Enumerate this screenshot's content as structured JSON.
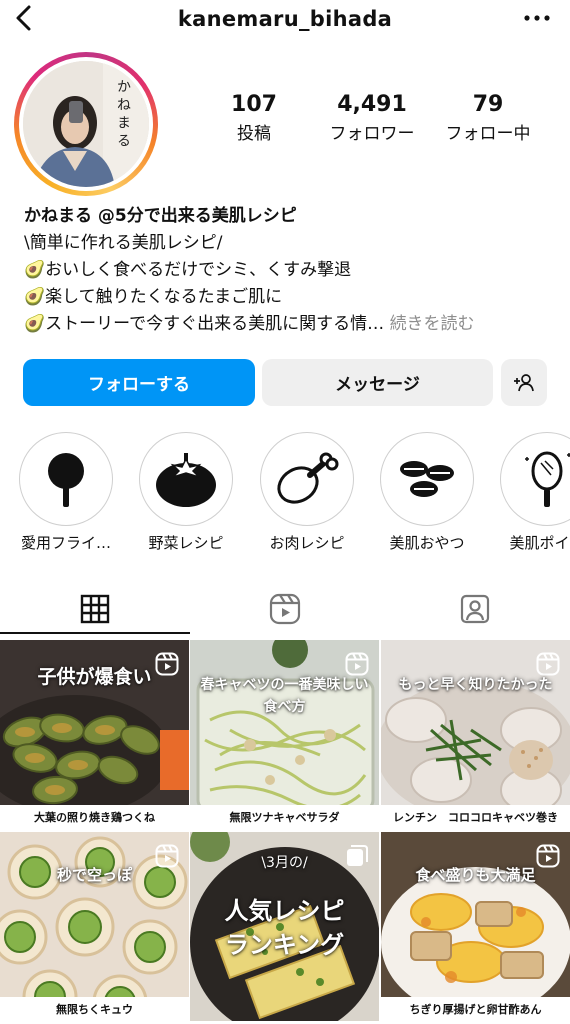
{
  "header": {
    "username": "kanemaru_bihada"
  },
  "profile": {
    "avatar_text": "かねまる",
    "stats": [
      {
        "value": "107",
        "label": "投稿"
      },
      {
        "value": "4,491",
        "label": "フォロワー"
      },
      {
        "value": "79",
        "label": "フォロー中"
      }
    ],
    "name": "かねまる @5分で出来る美肌レシピ",
    "bio_lines": [
      "\\簡単に作れる美肌レシピ/",
      "🥑おいしく食べるだけでシミ、くすみ撃退",
      "🥑楽して触りたくなるたまご肌に",
      "🥑ストーリーで今すぐ出来る美肌に関する情…"
    ],
    "more_label": "続きを読む"
  },
  "actions": {
    "follow_label": "フォローする",
    "message_label": "メッセージ"
  },
  "highlights": [
    {
      "label": "愛用フライ…",
      "icon": "frying-pan-icon"
    },
    {
      "label": "野菜レシピ",
      "icon": "tomato-icon"
    },
    {
      "label": "お肉レシピ",
      "icon": "chicken-leg-icon"
    },
    {
      "label": "美肌おやつ",
      "icon": "cookies-icon"
    },
    {
      "label": "美肌ポイン",
      "icon": "mirror-icon"
    }
  ],
  "tabs": [
    "grid",
    "reels",
    "tagged"
  ],
  "posts": [
    {
      "title": "子供が爆食い",
      "subtitle": "大葉の照り焼き鶏つくね",
      "type": "reel"
    },
    {
      "title": "春キャベツの一番美味しい\n食べ方",
      "subtitle": "無限ツナキャベサラダ",
      "type": "reel"
    },
    {
      "title": "もっと早く知りたかった",
      "subtitle": "レンチン　コロコロキャベツ巻き",
      "type": "reel"
    },
    {
      "title": "秒で空っぽ",
      "subtitle": "無限ちくキュウ",
      "type": "reel"
    },
    {
      "title": "人気レシピ\nランキング",
      "pre_title": "\\3月の/",
      "subtitle": "",
      "type": "carousel"
    },
    {
      "title": "食べ盛りも大満足",
      "subtitle": "ちぎり厚揚げと卵甘酢あん",
      "type": "reel"
    }
  ]
}
